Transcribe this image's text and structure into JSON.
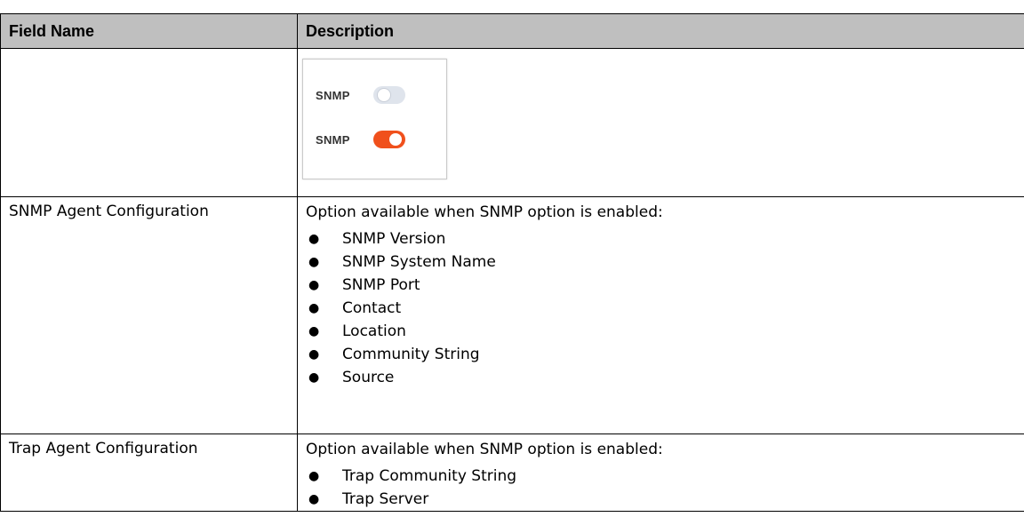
{
  "table": {
    "headers": {
      "field": "Field Name",
      "description": "Description"
    },
    "toggle_example": {
      "off_label": "SNMP",
      "on_label": "SNMP",
      "accent_color": "#f0501c",
      "off_color": "#dfe4ec"
    },
    "rows": [
      {
        "field": "SNMP Agent Configuration",
        "intro": "Option available when SNMP option is enabled:",
        "bullets": [
          "SNMP Version",
          "SNMP System Name",
          "SNMP Port",
          "Contact",
          "Location",
          "Community String",
          "Source"
        ]
      },
      {
        "field": "Trap Agent Configuration",
        "intro": "Option available when SNMP option is enabled:",
        "bullets": [
          "Trap Community String",
          "Trap Server"
        ]
      }
    ]
  }
}
